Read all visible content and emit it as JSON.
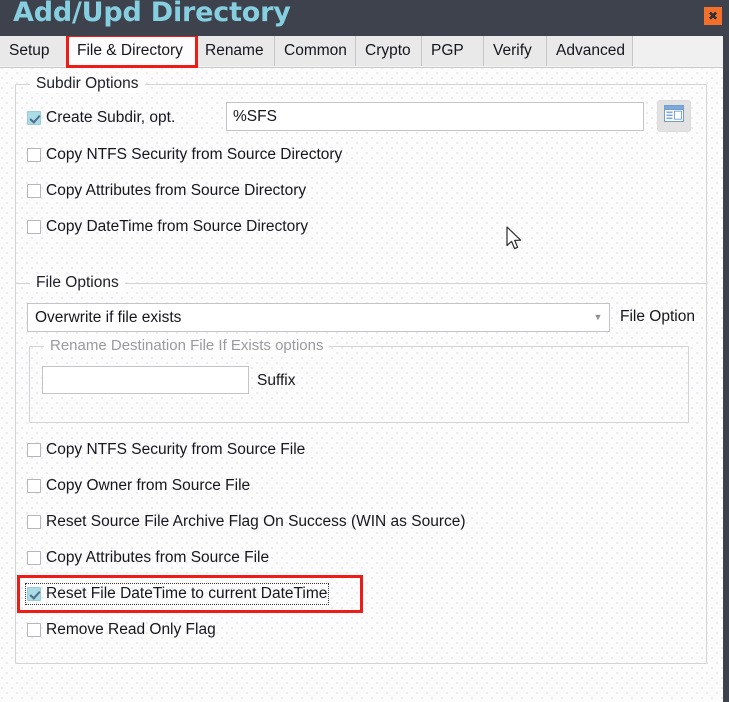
{
  "window": {
    "title": "Add/Upd Directory",
    "close_label": "✖",
    "titlebar_color": "#3d424c",
    "title_color": "#86cfe0",
    "close_color": "#f2702a",
    "accent_highlight": "#ee1c17"
  },
  "tabs": [
    {
      "label": "Setup",
      "selected": false
    },
    {
      "label": "File & Directory",
      "selected": true
    },
    {
      "label": "Rename",
      "selected": false
    },
    {
      "label": "Common",
      "selected": false
    },
    {
      "label": "Crypto",
      "selected": false
    },
    {
      "label": "PGP",
      "selected": false
    },
    {
      "label": "Verify",
      "selected": false
    },
    {
      "label": "Advanced",
      "selected": false
    }
  ],
  "subdir_options": {
    "legend": "Subdir Options",
    "create_subdir": {
      "label": "Create Subdir, opt.",
      "checked": true
    },
    "subdir_value": "%SFS",
    "subdir_placeholder": "",
    "browse_icon": "window-browse-icon",
    "checkboxes": [
      {
        "label": "Copy NTFS Security from Source Directory",
        "checked": false
      },
      {
        "label": "Copy Attributes from Source Directory",
        "checked": false
      },
      {
        "label": "Copy DateTime from Source Directory",
        "checked": false
      }
    ]
  },
  "file_options": {
    "legend": "File Options",
    "file_option_value": "Overwrite if file exists",
    "file_option_label": "File Option",
    "rename_group": {
      "legend": "Rename Destination File If Exists options",
      "disabled": true,
      "suffix_value": "",
      "suffix_placeholder": "",
      "suffix_label": "Suffix"
    },
    "checkboxes": [
      {
        "label": "Copy NTFS Security from Source File",
        "checked": false,
        "highlighted": false
      },
      {
        "label": "Copy Owner from Source File",
        "checked": false,
        "highlighted": false
      },
      {
        "label": "Reset Source File Archive Flag On Success (WIN as Source)",
        "checked": false,
        "highlighted": false
      },
      {
        "label": "Copy Attributes from Source File",
        "checked": false,
        "highlighted": false
      },
      {
        "label": "Reset File DateTime to current DateTime",
        "checked": true,
        "highlighted": true
      },
      {
        "label": "Remove Read Only Flag",
        "checked": false,
        "highlighted": false
      }
    ]
  }
}
